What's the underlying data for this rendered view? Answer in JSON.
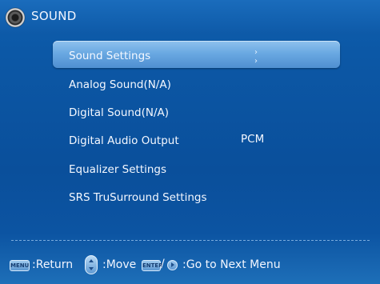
{
  "header": {
    "title": "SOUND",
    "icon": "speaker-icon"
  },
  "menu": {
    "items": [
      {
        "label": "Sound Settings",
        "selected": true,
        "arrows": "› ›"
      },
      {
        "label": "Analog Sound(N/A)"
      },
      {
        "label": "Digital Sound(N/A)"
      },
      {
        "label": "Digital Audio Output",
        "value": "PCM"
      },
      {
        "label": "Equalizer Settings"
      },
      {
        "label": "SRS TruSurround Settings"
      }
    ]
  },
  "footer": {
    "menu_key": "MENU",
    "return_label": ":Return",
    "move_label": ":Move",
    "enter_key": "ENTER",
    "next_label": ":Go to Next Menu",
    "slash": "/"
  }
}
